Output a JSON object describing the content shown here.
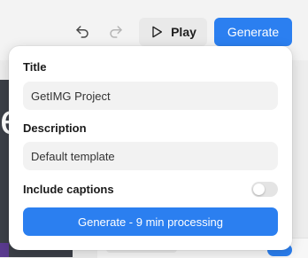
{
  "toolbar": {
    "undo_icon": "undo-icon",
    "redo_icon": "redo-icon",
    "play_label": "Play",
    "generate_label": "Generate"
  },
  "popover": {
    "title_label": "Title",
    "title_value": "GetIMG Project",
    "description_label": "Description",
    "description_value": "Default template",
    "captions_label": "Include captions",
    "captions_enabled": false,
    "submit_label": "Generate - 9 min processing"
  },
  "background": {
    "left_panel_glyph": "e"
  },
  "colors": {
    "accent": "#2b7ff0",
    "toggle_off": "#e4e4e4",
    "input_bg": "#f2f2f2"
  }
}
